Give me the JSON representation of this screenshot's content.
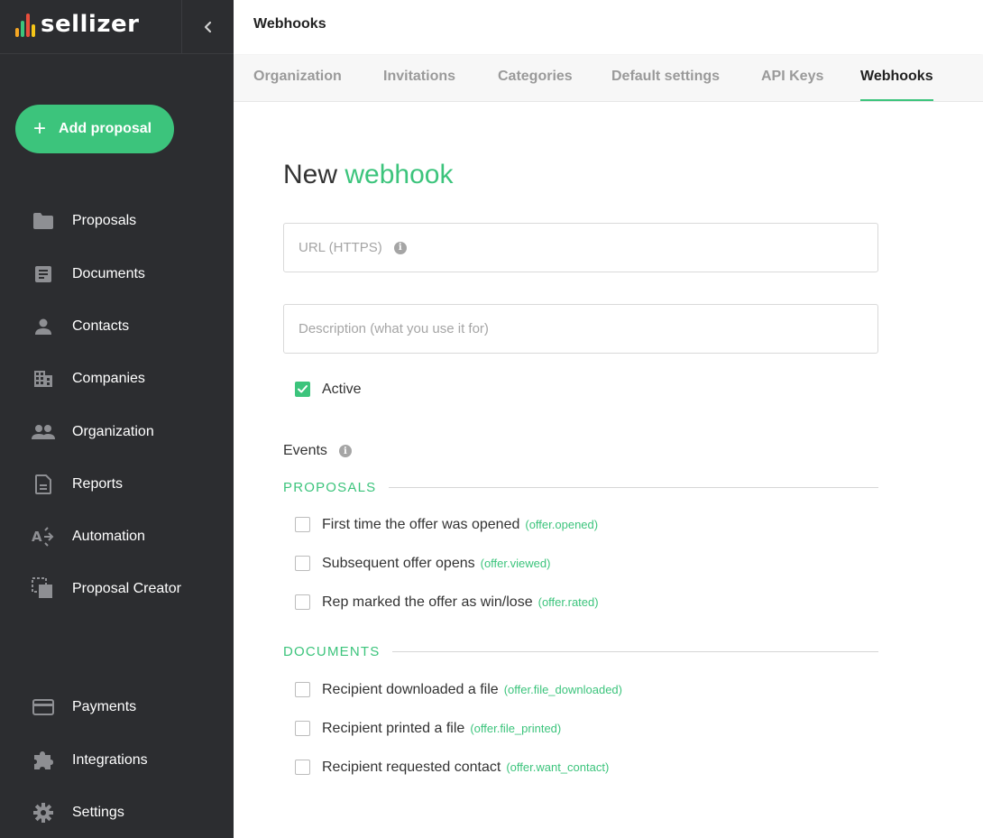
{
  "brand": {
    "name": "sellizer",
    "accent": "#3cc47c",
    "sidebar_bg": "#2c2d30"
  },
  "sidebar": {
    "add_button": "Add proposal",
    "items": [
      {
        "label": "Proposals",
        "icon": "folder-icon"
      },
      {
        "label": "Documents",
        "icon": "document-icon"
      },
      {
        "label": "Contacts",
        "icon": "person-icon"
      },
      {
        "label": "Companies",
        "icon": "building-icon"
      },
      {
        "label": "Organization",
        "icon": "people-icon"
      },
      {
        "label": "Reports",
        "icon": "report-icon"
      },
      {
        "label": "Automation",
        "icon": "automation-icon"
      },
      {
        "label": "Proposal Creator",
        "icon": "proposal-creator-icon"
      }
    ],
    "bottom_items": [
      {
        "label": "Payments",
        "icon": "credit-card-icon"
      },
      {
        "label": "Integrations",
        "icon": "puzzle-icon"
      },
      {
        "label": "Settings",
        "icon": "gear-icon"
      }
    ]
  },
  "header": {
    "title": "Webhooks"
  },
  "tabs": [
    {
      "label": "Organization"
    },
    {
      "label": "Invitations"
    },
    {
      "label": "Categories"
    },
    {
      "label": "Default settings"
    },
    {
      "label": "API Keys"
    },
    {
      "label": "Webhooks",
      "active": true
    }
  ],
  "form": {
    "title_plain": "New",
    "title_accent": "webhook",
    "url_placeholder": "URL (HTTPS)",
    "description_placeholder": "Description (what you use it for)",
    "active_label": "Active",
    "active_checked": true,
    "events_label": "Events"
  },
  "sections": [
    {
      "title": "PROPOSALS",
      "events": [
        {
          "label": "First time the offer was opened",
          "code": "(offer.opened)",
          "checked": false
        },
        {
          "label": "Subsequent offer opens",
          "code": "(offer.viewed)",
          "checked": false
        },
        {
          "label": "Rep marked the offer as win/lose",
          "code": "(offer.rated)",
          "checked": false
        }
      ]
    },
    {
      "title": "DOCUMENTS",
      "events": [
        {
          "label": "Recipient downloaded a file",
          "code": "(offer.file_downloaded)",
          "checked": false
        },
        {
          "label": "Recipient printed a file",
          "code": "(offer.file_printed)",
          "checked": false
        },
        {
          "label": "Recipient requested contact",
          "code": "(offer.want_contact)",
          "checked": false
        }
      ]
    }
  ]
}
